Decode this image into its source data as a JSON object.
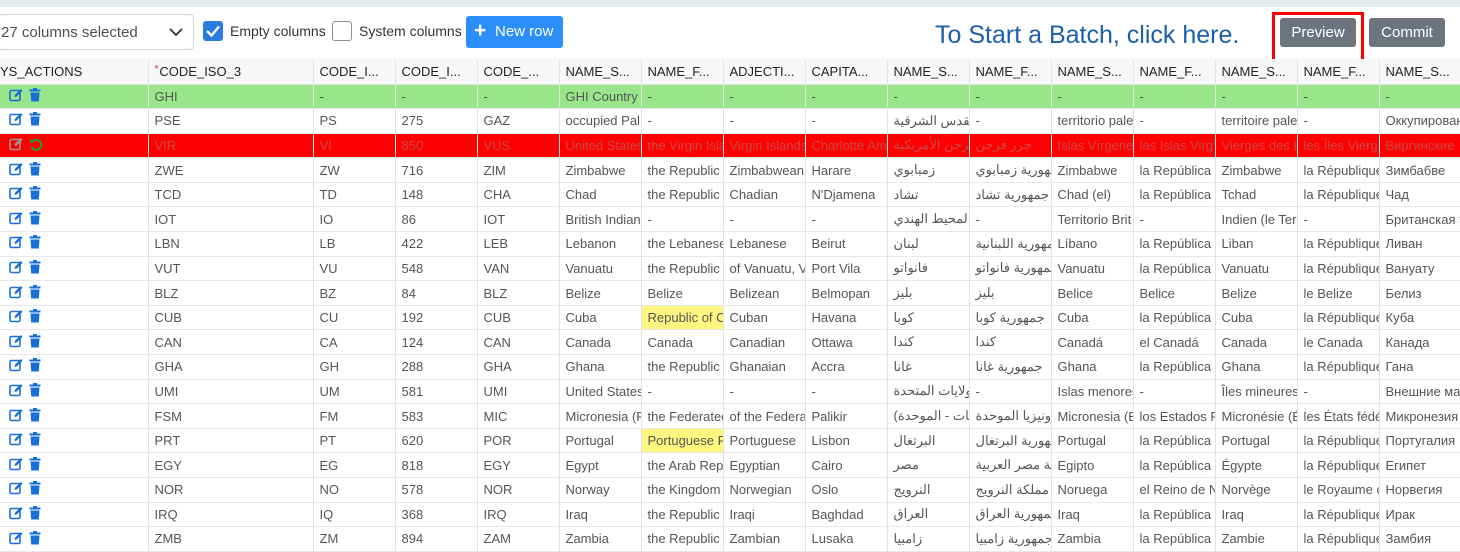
{
  "toolbar": {
    "columns_select_value": "27 columns selected",
    "empty_columns_label": "Empty columns",
    "empty_columns_checked": true,
    "system_columns_label": "System columns",
    "system_columns_checked": false,
    "new_row_label": "New row",
    "batch_hint": "To Start a Batch, click here.",
    "preview_label": "Preview",
    "commit_label": "Commit"
  },
  "colors": {
    "primary": "#2c8ef8",
    "new_row_bg": "#99e68a",
    "deleted_row_bg": "#ff0000",
    "modified_cell_bg": "#fff680",
    "highlight_outline": "#ff0000"
  },
  "grid": {
    "columns": [
      "YS_ACTIONS",
      "CODE_ISO_3",
      "CODE_I...",
      "CODE_I...",
      "CODE_...",
      "NAME_S...",
      "NAME_F...",
      "ADJECTI...",
      "CAPITA...",
      "NAME_S...",
      "NAME_F...",
      "NAME_S...",
      "NAME_F...",
      "NAME_S...",
      "NAME_F...",
      "NAME_S..."
    ],
    "required_column_index": 1,
    "rows": [
      {
        "state": "new",
        "cells": [
          "GHI",
          "-",
          "-",
          "-",
          "GHI Country",
          "-",
          "-",
          "-",
          "-",
          "-",
          "-",
          "-",
          "-",
          "-",
          "-"
        ]
      },
      {
        "state": "normal",
        "cells": [
          "PSE",
          "PS",
          "275",
          "GAZ",
          "occupied Pal",
          "-",
          "-",
          "-",
          "فيها القدس الشرقية",
          "-",
          "territorio pale",
          "-",
          "territoire pale",
          "-",
          "Оккупирован"
        ]
      },
      {
        "state": "deleted",
        "cells": [
          "VIR",
          "VI",
          "850",
          "VUS",
          "United States",
          "the Virgin Isla",
          "Virgin Islands",
          "Charlotte Am",
          "جزر فرجن الأمريكية",
          "جزر فرجن",
          "Islas Vírgene",
          "las Islas Virg",
          "Vierges des É",
          "les Îles Vierg",
          "Виргинские"
        ]
      },
      {
        "state": "normal",
        "cells": [
          "ZWE",
          "ZW",
          "716",
          "ZIM",
          "Zimbabwe",
          "the Republic",
          "Zimbabwean",
          "Harare",
          "زمبابوي",
          "جمهورية زمبابوي",
          "Zimbabwe",
          "la República",
          "Zimbabwe",
          "la République",
          "Зимбабве"
        ]
      },
      {
        "state": "normal",
        "cells": [
          "TCD",
          "TD",
          "148",
          "CHA",
          "Chad",
          "the Republic",
          "Chadian",
          "N'Djamena",
          "تشاد",
          "جمهورية تشاد",
          "Chad (el)",
          "la República",
          "Tchad",
          "la République",
          "Чад"
        ]
      },
      {
        "state": "normal",
        "cells": [
          "IOT",
          "IO",
          "86",
          "IOT",
          "British Indian",
          "-",
          "-",
          "-",
          "في المحيط الهندي",
          "-",
          "Territorio Brit",
          "-",
          "Indien (le Ter",
          "-",
          "Британская т"
        ]
      },
      {
        "state": "normal",
        "cells": [
          "LBN",
          "LB",
          "422",
          "LEB",
          "Lebanon",
          "the Lebanese",
          "Lebanese",
          "Beirut",
          "لبنان",
          "الجمهورية اللبنانية",
          "Líbano",
          "la República",
          "Liban",
          "la République",
          "Ливан"
        ]
      },
      {
        "state": "normal",
        "cells": [
          "VUT",
          "VU",
          "548",
          "VAN",
          "Vanuatu",
          "the Republic",
          "of Vanuatu, V",
          "Port Vila",
          "فانواتو",
          "جمهورية فانواتو",
          "Vanuatu",
          "la República",
          "Vanuatu",
          "la République",
          "Вануату"
        ]
      },
      {
        "state": "normal",
        "cells": [
          "BLZ",
          "BZ",
          "84",
          "BLZ",
          "Belize",
          "Belize",
          "Belizean",
          "Belmopan",
          "بليز",
          "بليز",
          "Belice",
          "Belice",
          "Belize",
          "le Belize",
          "Белиз"
        ]
      },
      {
        "state": "normal",
        "hl": [
          5
        ],
        "cells": [
          "CUB",
          "CU",
          "192",
          "CUB",
          "Cuba",
          "Republic of C",
          "Cuban",
          "Havana",
          "كوبا",
          "جمهورية كوبا",
          "Cuba",
          "la República",
          "Cuba",
          "la République",
          "Куба"
        ]
      },
      {
        "state": "normal",
        "cells": [
          "CAN",
          "CA",
          "124",
          "CAN",
          "Canada",
          "Canada",
          "Canadian",
          "Ottawa",
          "كندا",
          "كندا",
          "Canadá",
          "el Canadá",
          "Canada",
          "le Canada",
          "Канада"
        ]
      },
      {
        "state": "normal",
        "cells": [
          "GHA",
          "GH",
          "288",
          "GHA",
          "Ghana",
          "the Republic",
          "Ghanaian",
          "Accra",
          "غانا",
          "جمهورية غانا",
          "Ghana",
          "la República",
          "Ghana",
          "la République",
          "Гана"
        ]
      },
      {
        "state": "normal",
        "cells": [
          "UMI",
          "UM",
          "581",
          "UMI",
          "United States",
          "-",
          "-",
          "-",
          "عة للولايات المتحدة",
          "-",
          "Islas menores",
          "-",
          "Îles mineures",
          "-",
          "Внешние ма."
        ]
      },
      {
        "state": "normal",
        "cells": [
          "FSM",
          "FM",
          "583",
          "MIC",
          "Micronesia (F",
          "the Federatec",
          "of the Federa",
          "Palikir",
          "(ولايات - الموحدة)",
          "ميكرونيزيا الموحدة",
          "Micronesia (E",
          "los Estados F",
          "Micronésie (É",
          "les États fédé",
          "Микронезия"
        ]
      },
      {
        "state": "normal",
        "hl": [
          5
        ],
        "cells": [
          "PRT",
          "PT",
          "620",
          "POR",
          "Portugal",
          "Portuguese R",
          "Portuguese",
          "Lisbon",
          "البرتغال",
          "جمهورية البرتغال",
          "Portugal",
          "la República",
          "Portugal",
          "la République",
          "Португалия"
        ]
      },
      {
        "state": "normal",
        "cells": [
          "EGY",
          "EG",
          "818",
          "EGY",
          "Egypt",
          "the Arab Rep",
          "Egyptian",
          "Cairo",
          "مصر",
          "ورية مصر العربية",
          "Egipto",
          "la República",
          "Égypte",
          "la République",
          "Египет"
        ]
      },
      {
        "state": "normal",
        "cells": [
          "NOR",
          "NO",
          "578",
          "NOR",
          "Norway",
          "the Kingdom",
          "Norwegian",
          "Oslo",
          "النرويج",
          "مملكة النرويج",
          "Noruega",
          "el Reino de N",
          "Norvège",
          "le Royaume c",
          "Норвегия"
        ]
      },
      {
        "state": "normal",
        "cells": [
          "IRQ",
          "IQ",
          "368",
          "IRQ",
          "Iraq",
          "the Republic",
          "Iraqi",
          "Baghdad",
          "العراق",
          "جمهورية العراق",
          "Iraq",
          "la República",
          "Iraq",
          "la République",
          "Ирак"
        ]
      },
      {
        "state": "normal",
        "cells": [
          "ZMB",
          "ZM",
          "894",
          "ZAM",
          "Zambia",
          "the Republic",
          "Zambian",
          "Lusaka",
          "زامبيا",
          "جمهورية زامبيا",
          "Zambia",
          "la República",
          "Zambie",
          "la République",
          "Замбия"
        ]
      }
    ]
  }
}
